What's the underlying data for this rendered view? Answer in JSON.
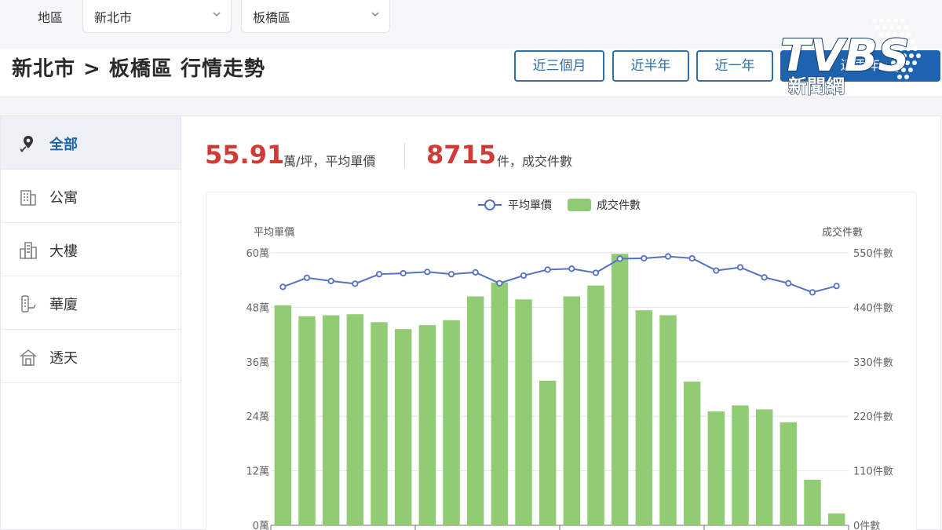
{
  "filters": {
    "label": "地區",
    "city": "新北市",
    "district": "板橋區"
  },
  "header": {
    "title": "新北市 > 板橋區 行情走勢",
    "ranges": [
      "近三個月",
      "近半年",
      "近一年",
      "近兩年"
    ],
    "active_range": 3
  },
  "logo": {
    "brand": "TVBS",
    "sub": "新聞網"
  },
  "sidebar": {
    "items": [
      {
        "label": "全部",
        "icon": "map-pin-icon"
      },
      {
        "label": "公寓",
        "icon": "apartment-icon"
      },
      {
        "label": "大樓",
        "icon": "building-icon"
      },
      {
        "label": "華廈",
        "icon": "mansion-icon"
      },
      {
        "label": "透天",
        "icon": "house-icon"
      }
    ],
    "active": 0
  },
  "stats": {
    "price": "55.91",
    "price_label": "萬/坪，平均單價",
    "count": "8715",
    "count_label": "件，成交件數"
  },
  "colors": {
    "accent": "#1d63ad",
    "price_red": "#d23a36",
    "bar": "#91cc75",
    "line": "#5470c6"
  },
  "chart_data": {
    "type": "bar",
    "legend": [
      "平均單價",
      "成交件數"
    ],
    "left_axis": {
      "title": "平均單價",
      "min": 0,
      "max": 60,
      "ticks": [
        "0萬",
        "12萬",
        "24萬",
        "36萬",
        "48萬",
        "60萬"
      ]
    },
    "right_axis": {
      "title": "成交件數",
      "min": 0,
      "max": 550,
      "ticks": [
        "0件數",
        "110件數",
        "220件數",
        "330件數",
        "440件數",
        "550件數"
      ]
    },
    "series": [
      {
        "name": "平均單價",
        "type": "line",
        "values": [
          52.5,
          54.5,
          53.8,
          53.2,
          55.3,
          55.5,
          55.8,
          55.3,
          55.7,
          53.3,
          55,
          56.3,
          56.5,
          55.6,
          58.7,
          58.8,
          59.2,
          58.8,
          56.1,
          56.8,
          54.6,
          53.3,
          51.3,
          52.7
        ]
      },
      {
        "name": "成交件數",
        "type": "bar",
        "values": [
          444,
          422,
          424,
          426,
          410,
          396,
          404,
          414,
          462,
          490,
          456,
          292,
          462,
          484,
          548,
          434,
          424,
          290,
          230,
          242,
          234,
          208,
          92,
          24
        ]
      }
    ]
  }
}
